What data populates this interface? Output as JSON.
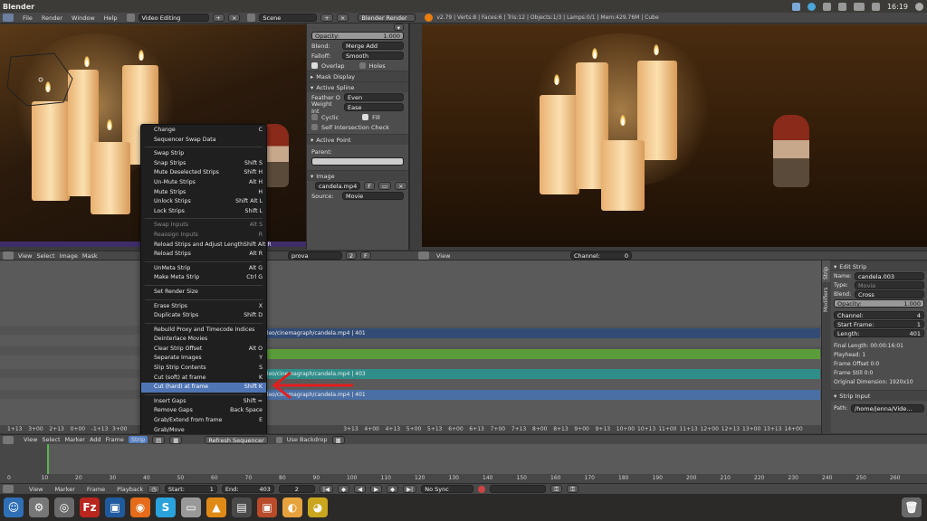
{
  "sysbar": {
    "title": "Blender",
    "clock": "16:19"
  },
  "header": {
    "menus": [
      "File",
      "Render",
      "Window",
      "Help"
    ],
    "screen": "Video Editing",
    "scene": "Scene",
    "engine": "Blender Render",
    "stats": "v2.79 | Verts:8 | Faces:6 | Tris:12 | Objects:1/3 | Lamps:0/1 | Mem:429.76M | Cube"
  },
  "panel": {
    "opacity_label": "Opacity:",
    "opacity_value": "1.000",
    "blend_label": "Blend:",
    "blend_value": "Merge Add",
    "falloff_label": "Falloff:",
    "falloff_value": "Smooth",
    "overlap": "Overlap",
    "holes": "Holes",
    "mask_display": "Mask Display",
    "active_spline": "Active Spline",
    "feather_label": "Feather O",
    "feather_value": "Even",
    "weight_label": "Weight Int",
    "weight_value": "Ease",
    "cyclic": "Cyclic",
    "fill": "Fill",
    "self_intersection": "Self Intersection Check",
    "active_point": "Active Point",
    "parent": "Parent:",
    "image": "Image",
    "image_file": "candela.mp4",
    "image_users": "F",
    "source_label": "Source:",
    "source_value": "Movie"
  },
  "seq_header_left": {
    "items": [
      "View",
      "Select",
      "Image",
      "Mask"
    ],
    "mask_name": "prova",
    "mask_num": "2",
    "mask_flag": "F"
  },
  "seq_header_right": {
    "items": [
      "View"
    ],
    "channel_label": "Channel:",
    "channel_value": "0"
  },
  "menu": {
    "items": [
      {
        "label": "Change",
        "key": "C",
        "disabled": false
      },
      {
        "label": "Sequencer Swap Data",
        "key": "",
        "disabled": false
      },
      {
        "sep": true
      },
      {
        "label": "Swap Strip",
        "key": "",
        "disabled": false
      },
      {
        "label": "Snap Strips",
        "key": "Shift S",
        "disabled": false
      },
      {
        "label": "Mute Deselected Strips",
        "key": "Shift H",
        "disabled": false
      },
      {
        "label": "Un-Mute Strips",
        "key": "Alt H",
        "disabled": false
      },
      {
        "label": "Mute Strips",
        "key": "H",
        "disabled": false
      },
      {
        "label": "Unlock Strips",
        "key": "Shift Alt L",
        "disabled": false
      },
      {
        "label": "Lock Strips",
        "key": "Shift L",
        "disabled": false
      },
      {
        "sep": true
      },
      {
        "label": "Swap Inputs",
        "key": "Alt S",
        "disabled": true
      },
      {
        "label": "Reassign Inputs",
        "key": "R",
        "disabled": true
      },
      {
        "label": "Reload Strips and Adjust Length",
        "key": "Shift Alt R",
        "disabled": false
      },
      {
        "label": "Reload Strips",
        "key": "Alt R",
        "disabled": false
      },
      {
        "sep": true
      },
      {
        "label": "UnMeta Strip",
        "key": "Alt G",
        "disabled": false
      },
      {
        "label": "Make Meta Strip",
        "key": "Ctrl G",
        "disabled": false
      },
      {
        "sep": true
      },
      {
        "label": "Set Render Size",
        "key": "",
        "disabled": false
      },
      {
        "sep": true
      },
      {
        "label": "Erase Strips",
        "key": "X",
        "disabled": false
      },
      {
        "label": "Duplicate Strips",
        "key": "Shift D",
        "disabled": false
      },
      {
        "sep": true
      },
      {
        "label": "Rebuild Proxy and Timecode Indices",
        "key": "",
        "disabled": false
      },
      {
        "label": "Deinterlace Movies",
        "key": "",
        "disabled": false
      },
      {
        "label": "Clear Strip Offset",
        "key": "Alt O",
        "disabled": false
      },
      {
        "label": "Separate Images",
        "key": "Y",
        "disabled": false
      },
      {
        "label": "Slip Strip Contents",
        "key": "S",
        "disabled": false
      },
      {
        "label": "Cut (soft) at frame",
        "key": "K",
        "disabled": false
      },
      {
        "label": "Cut (hard) at frame",
        "key": "Shift K",
        "disabled": false,
        "highlight": true
      },
      {
        "sep": true
      },
      {
        "label": "Insert Gaps",
        "key": "Shift =",
        "disabled": false
      },
      {
        "label": "Remove Gaps",
        "key": "Back Space",
        "disabled": false
      },
      {
        "label": "Grab/Extend from frame",
        "key": "E",
        "disabled": false
      },
      {
        "label": "Grab/Move",
        "key": "",
        "disabled": false
      }
    ]
  },
  "strips": {
    "s1": "ideo/cinemagraph/candela.mp4 | 401",
    "s3": "ideo/cinemagraph/candela.mp4 | 403",
    "s4": "ideo/cinemagraph/candela.mp4 | 401"
  },
  "seq_ruler": [
    "1+13",
    "3+00",
    "2+13",
    "0+00",
    "-1+13",
    "3+00",
    "",
    "",
    "",
    "",
    "",
    "",
    "",
    "",
    "",
    "",
    "3+13",
    "4+00",
    "4+13",
    "5+00",
    "5+13",
    "6+00",
    "6+13",
    "7+00",
    "7+13",
    "8+00",
    "8+13",
    "9+00",
    "9+13",
    "10+00",
    "10+13",
    "11+00",
    "11+13",
    "12+00",
    "12+13",
    "13+00",
    "13+13",
    "14+00"
  ],
  "right_panel": {
    "title": "Edit Strip",
    "tab_strip": "Strip",
    "tab_modifiers": "Modifiers",
    "name_label": "Name:",
    "name_value": "candela.003",
    "type_label": "Type:",
    "type_value": "Movie",
    "blend_label": "Blend:",
    "blend_value": "Cross",
    "opacity_label": "Opacity:",
    "opacity_value": "1.000",
    "channel_label": "Channel:",
    "channel_value": "4",
    "start_label": "Start Frame:",
    "start_value": "1",
    "length_label": "Length:",
    "length_value": "401",
    "final_length": "Final Length: 00:00:16:01",
    "playhead": "Playhead: 1",
    "frame_offset": "Frame Offset 0:0",
    "frame_still": "Frame Still 0:0",
    "orig_dim": "Original Dimension: 1920x10",
    "strip_input": "Strip Input",
    "path_label": "Path:",
    "path_value": "/home/jenna/Vide..."
  },
  "bottom_seq_header": {
    "items": [
      "View",
      "Select",
      "Marker",
      "Add",
      "Frame",
      "Strip"
    ],
    "refresh": "Refresh Sequencer",
    "backdrop": "Use Backdrop"
  },
  "timeline_ruler": [
    "0",
    "10",
    "20",
    "30",
    "40",
    "50",
    "60",
    "70",
    "80",
    "90",
    "100",
    "110",
    "120",
    "130",
    "140",
    "150",
    "160",
    "170",
    "180",
    "190",
    "200",
    "210",
    "220",
    "230",
    "240",
    "250",
    "260"
  ],
  "timeline_header": {
    "items": [
      "View",
      "Marker",
      "Frame",
      "Playback"
    ],
    "start_label": "Start:",
    "start_value": "1",
    "end_label": "End:",
    "end_value": "403",
    "current": "2",
    "sync": "No Sync"
  },
  "dock": {
    "apps": [
      "finder-icon",
      "settings-icon",
      "disk-icon",
      "filezilla-icon",
      "virtualbox-icon",
      "firefox-icon",
      "skype-icon",
      "drive-icon",
      "vlc-icon",
      "tv-icon",
      "screenshot-icon",
      "blender-icon",
      "cheese-icon"
    ]
  }
}
